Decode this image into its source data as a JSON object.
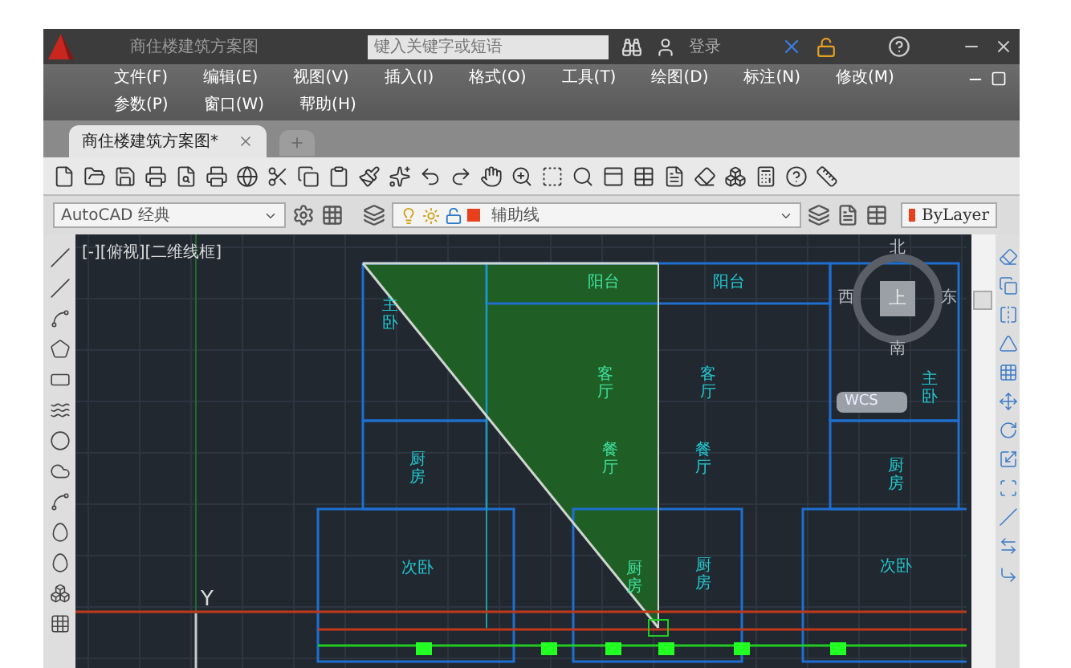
{
  "title_bar": {
    "title": "商住楼建筑方案图",
    "search": {
      "placeholder": "键入关键字或短语"
    },
    "sign_in": "登录"
  },
  "menu_bar": {
    "rows": [
      [
        "文件(F)",
        "编辑(E)",
        "视图(V)",
        "插入(I)",
        "格式(O)",
        "工具(T)",
        "绘图(D)",
        "标注(N)",
        "修改(M)"
      ],
      [
        "参数(P)",
        "窗口(W)",
        "帮助(H)"
      ]
    ]
  },
  "document_tabs": [
    {
      "label": "商住楼建筑方案图*",
      "selected": true
    }
  ],
  "workspace": {
    "value": "AutoCAD 经典"
  },
  "layer": {
    "value": "辅助线"
  },
  "color_control": {
    "value": "ByLayer"
  },
  "viewport": {
    "label": "[-][俯视][二维线框]"
  },
  "view_cube": {
    "face": "上",
    "compass": [
      "北",
      "东",
      "南",
      "西"
    ],
    "ucs": "WCS"
  },
  "axis_label": "Y",
  "rooms": [
    {
      "label": "主卧",
      "kind": "vertical"
    },
    {
      "label": "厨房",
      "kind": "vertical"
    },
    {
      "label": "次卧",
      "kind": "horizontal"
    },
    {
      "label": "阳台",
      "kind": "horizontal"
    },
    {
      "label": "阳台",
      "kind": "horizontal"
    },
    {
      "label": "客厅",
      "kind": "vertical"
    },
    {
      "label": "客厅",
      "kind": "vertical"
    },
    {
      "label": "餐厅",
      "kind": "vertical"
    },
    {
      "label": "餐厅",
      "kind": "vertical"
    },
    {
      "label": "厨房",
      "kind": "vertical"
    },
    {
      "label": "厨房",
      "kind": "vertical"
    },
    {
      "label": "主卧",
      "kind": "vertical"
    },
    {
      "label": "厨房",
      "kind": "vertical"
    },
    {
      "label": "次卧",
      "kind": "horizontal"
    }
  ]
}
